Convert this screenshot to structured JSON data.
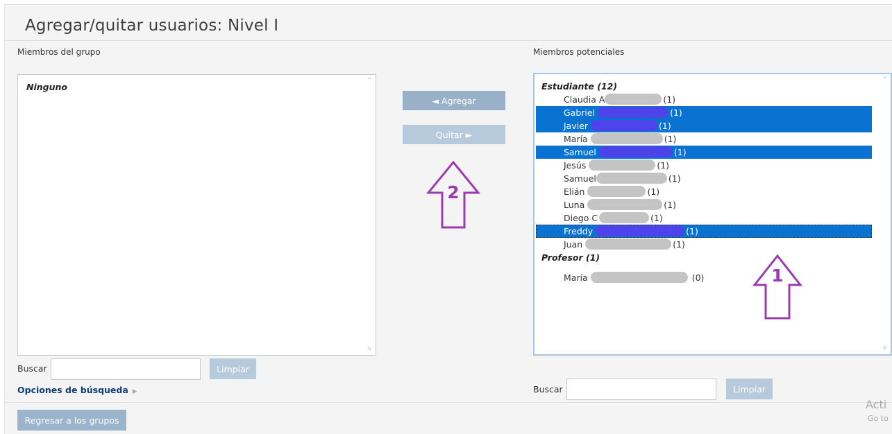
{
  "page": {
    "title": "Agregar/quitar usuarios: Nivel I"
  },
  "group_members": {
    "label": "Miembros del grupo",
    "empty_text": "Ninguno"
  },
  "potential_members": {
    "label": "Miembros potenciales",
    "groups": [
      {
        "label": "Estudiante (12)"
      },
      {
        "label": "Profesor (1)"
      }
    ],
    "students": [
      {
        "name": "Claudia A",
        "count": "(1)",
        "selected": false
      },
      {
        "name": "Gabriel",
        "count": "(1)",
        "selected": true
      },
      {
        "name": "Javier",
        "count": "(1)",
        "selected": true
      },
      {
        "name": "María",
        "count": "(1)",
        "selected": false
      },
      {
        "name": "Samuel",
        "count": "(1)",
        "selected": true
      },
      {
        "name": "Jesús",
        "count": "(1)",
        "selected": false
      },
      {
        "name": "Samuel",
        "count": "(1)",
        "selected": false
      },
      {
        "name": "Elián",
        "count": "(1)",
        "selected": false
      },
      {
        "name": "Luna",
        "count": "(1)",
        "selected": false
      },
      {
        "name": "Diego C",
        "count": "(1)",
        "selected": false
      },
      {
        "name": "Freddy",
        "count": "(1)",
        "selected": true
      },
      {
        "name": "Juan",
        "count": "(1)",
        "selected": false
      }
    ],
    "teachers": [
      {
        "name": "María",
        "count": "(0)",
        "selected": false
      }
    ]
  },
  "buttons": {
    "add": "◄ Agregar",
    "remove": "Quitar ►",
    "clear": "Limpiar",
    "back": "Regresar a los grupos"
  },
  "search": {
    "label": "Buscar"
  },
  "search_options": {
    "label": "Opciones de búsqueda"
  },
  "annotations": {
    "arrow1": "1",
    "arrow2": "2"
  },
  "watermark": {
    "line1": "Acti",
    "line2": "Go to"
  },
  "colors": {
    "selection": "#0a72d1",
    "arrow": "#9b3bb0",
    "link": "#0f3d78"
  }
}
